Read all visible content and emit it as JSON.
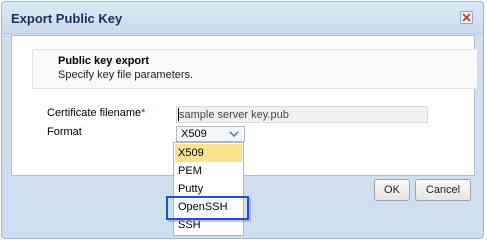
{
  "dialog": {
    "title": "Export Public Key",
    "close_icon": "close-icon"
  },
  "header": {
    "title": "Public key export",
    "subtitle": "Specify key file parameters."
  },
  "form": {
    "certificate_label": "Certificate filename",
    "required_marker": "*",
    "certificate_value": "sample server key.pub",
    "format_label": "Format",
    "format_value": "X509"
  },
  "dropdown": {
    "options": [
      "X509",
      "PEM",
      "Putty",
      "OpenSSH",
      "SSH"
    ],
    "selected": "X509",
    "highlighted": "OpenSSH"
  },
  "buttons": {
    "ok": "OK",
    "cancel": "Cancel"
  },
  "colors": {
    "selected_option": "#fbe28e",
    "highlight_border": "#1f4fd0",
    "required": "#cc0000"
  }
}
